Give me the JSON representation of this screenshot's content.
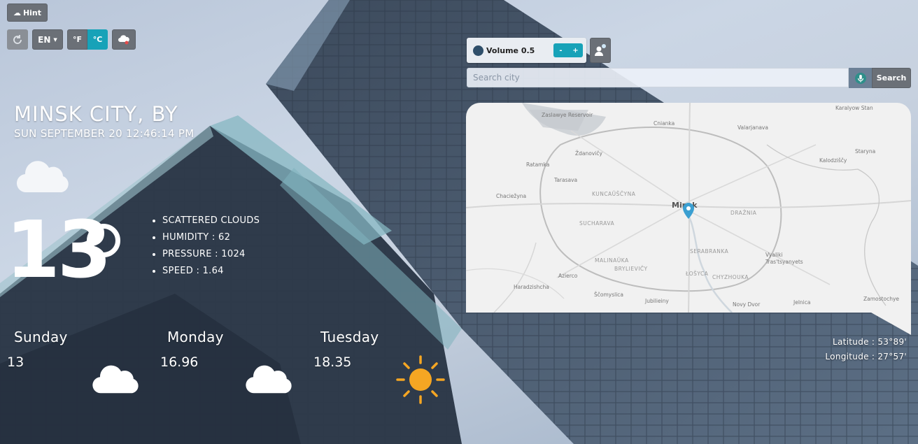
{
  "controls": {
    "hint_label": "Hint",
    "lang_label": "EN",
    "unit_f": "°F",
    "unit_c": "°C"
  },
  "audio": {
    "volume_label": "Volume 0.5",
    "minus": "-",
    "plus": "+"
  },
  "search": {
    "placeholder": "Search city",
    "button_label": "Search"
  },
  "location": {
    "city": "MINSK CITY, BY",
    "datetime": "SUN SEPTEMBER 20 12:46:14 PM",
    "latitude": "Latitude : 53°89'",
    "longitude": "Longitude : 27°57'"
  },
  "current": {
    "temperature": "13",
    "description": "SCATTERED CLOUDS",
    "humidity": "HUMIDITY : 62",
    "pressure": "PRESSURE : 1024",
    "speed": "SPEED : 1.64",
    "icon": "cloud-icon"
  },
  "forecast": [
    {
      "day": "Sunday",
      "temp": "13",
      "icon": "cloud-icon"
    },
    {
      "day": "Monday",
      "temp": "16.96",
      "icon": "cloud-icon"
    },
    {
      "day": "Tuesday",
      "temp": "18.35",
      "icon": "sun-icon"
    }
  ],
  "map": {
    "marker_city": "Minsk",
    "labels": [
      "Zaslawye Reservoir",
      "Cnianka",
      "Valarjanava",
      "Karalyow Stan",
      "Ždanovičy",
      "Ratamka",
      "Staryna",
      "Kalodziščy",
      "Tarasava",
      "KUNCAŬŠČYNA",
      "Chaciežyna",
      "DRAŽNIA",
      "SUCHARAVA",
      "SERABRANKA",
      "MALINAŬKA",
      "BRYLIEVIČY",
      "Vyaliki Tras'tsyanyets",
      "Azierco",
      "ŁOŠYCA",
      "CHYZHOUKA",
      "Haradzishcha",
      "Ščomyslica",
      "Jubilieiny",
      "Novy Dvor",
      "Jelnica",
      "Zamostochye"
    ]
  },
  "colors": {
    "accent": "#17a2b8",
    "button_grey": "#6b7077",
    "sun": "#f5a623",
    "marker": "#3b9fd1"
  }
}
